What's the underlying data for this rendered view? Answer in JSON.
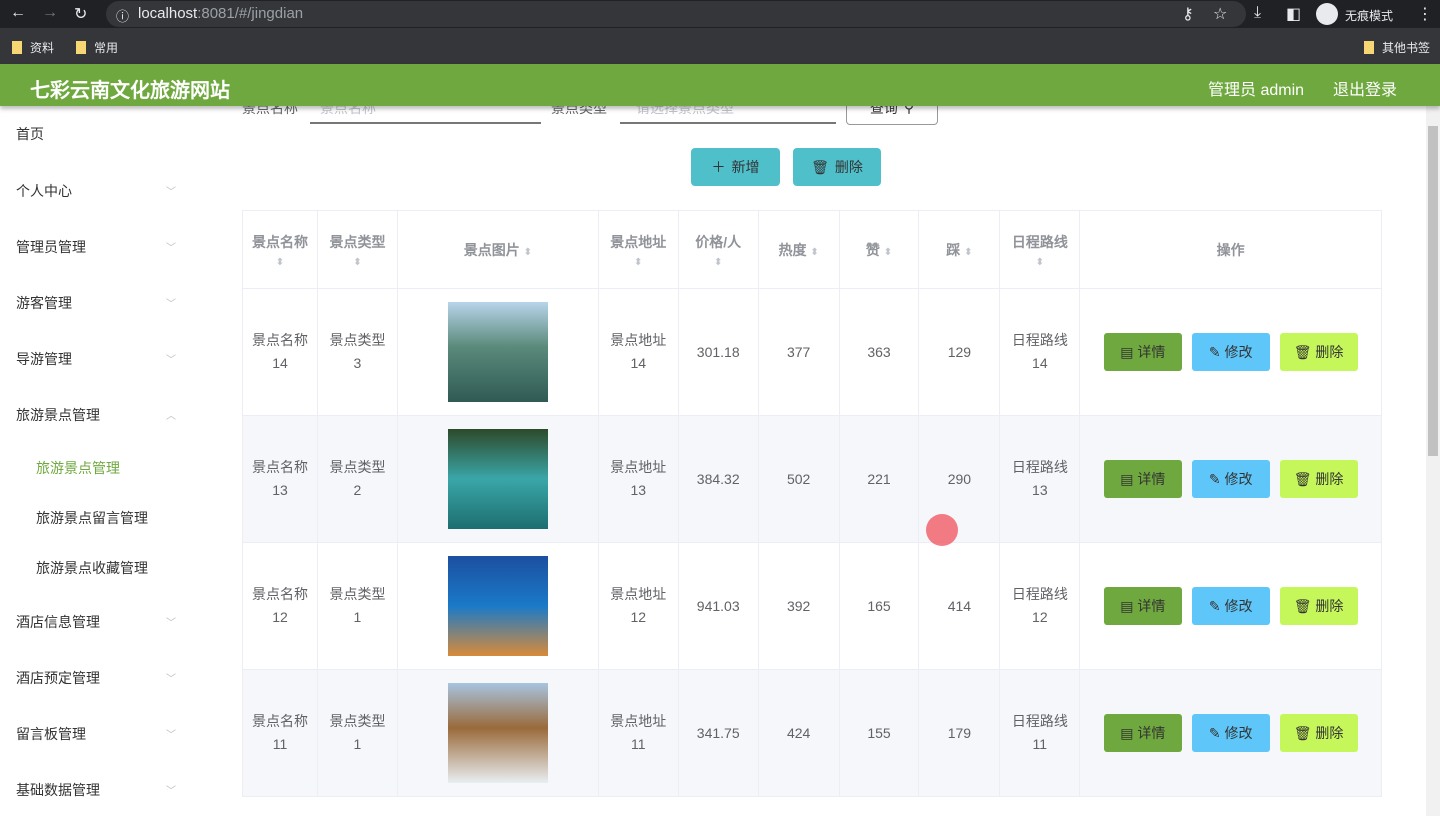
{
  "browser": {
    "url_host": "localhost",
    "url_rest": ":8081/#/jingdian",
    "incognito": "无痕模式",
    "bookmarks": [
      "资料",
      "常用"
    ],
    "other_bookmarks": "其他书签"
  },
  "header": {
    "title": "七彩云南文化旅游网站",
    "user": "管理员 admin",
    "logout": "退出登录"
  },
  "sidebar": {
    "items": [
      "首页",
      "个人中心",
      "管理员管理",
      "游客管理",
      "导游管理",
      "旅游景点管理"
    ],
    "sub": [
      "旅游景点管理",
      "旅游景点留言管理",
      "旅游景点收藏管理"
    ],
    "items2": [
      "酒店信息管理",
      "酒店预定管理",
      "留言板管理",
      "基础数据管理"
    ]
  },
  "search": {
    "name_label": "景点名称",
    "name_placeholder": "景点名称",
    "type_label": "景点类型",
    "type_placeholder": "请选择景点类型",
    "query": "查询"
  },
  "actions": {
    "add": "新增",
    "delete": "删除"
  },
  "table": {
    "headers": [
      "景点名称",
      "景点类型",
      "景点图片",
      "景点地址",
      "价格/人",
      "热度",
      "赞",
      "踩",
      "日程路线",
      "操作"
    ],
    "row_actions": {
      "detail": "详情",
      "edit": "修改",
      "delete": "删除"
    },
    "rows": [
      {
        "name": "景点名称14",
        "type": "景点类型3",
        "addr": "景点地址14",
        "price": "301.18",
        "hot": "377",
        "up": "363",
        "down": "129",
        "route": "日程路线14"
      },
      {
        "name": "景点名称13",
        "type": "景点类型2",
        "addr": "景点地址13",
        "price": "384.32",
        "hot": "502",
        "up": "221",
        "down": "290",
        "route": "日程路线13"
      },
      {
        "name": "景点名称12",
        "type": "景点类型1",
        "addr": "景点地址12",
        "price": "941.03",
        "hot": "392",
        "up": "165",
        "down": "414",
        "route": "日程路线12"
      },
      {
        "name": "景点名称11",
        "type": "景点类型1",
        "addr": "景点地址11",
        "price": "341.75",
        "hot": "424",
        "up": "155",
        "down": "179",
        "route": "日程路线11"
      }
    ]
  },
  "colors": {
    "brand": "#6fa83f",
    "teal": "#4fbfca",
    "detail": "#6fa83f",
    "edit": "#5fc6f9",
    "delete": "#c6f75a"
  }
}
